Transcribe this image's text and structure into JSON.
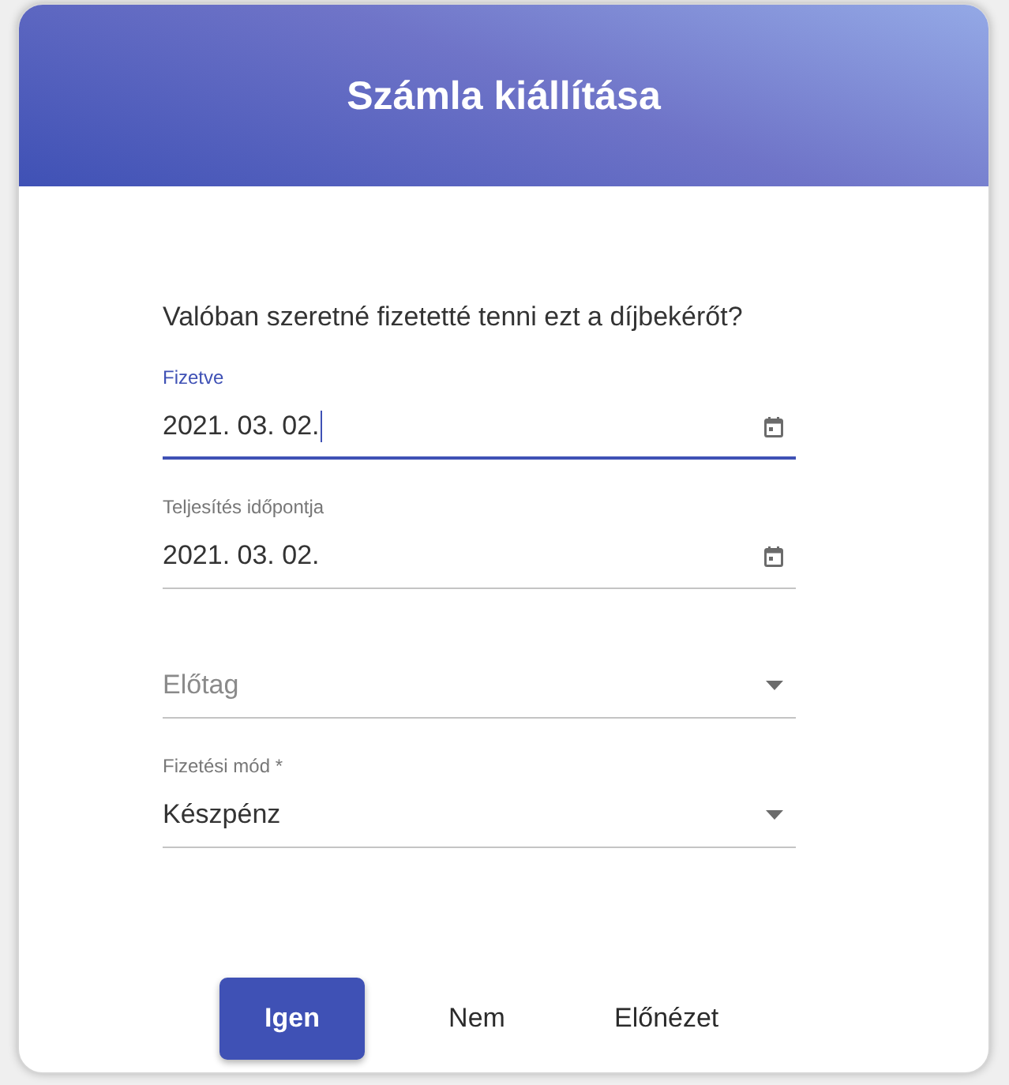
{
  "title": "Számla kiállítása",
  "question": "Valóban szeretné fizetetté tenni ezt a díjbekérőt?",
  "fields": [
    {
      "kind": "date",
      "label": "Fizetve",
      "value": "2021. 03. 02.",
      "focused": true
    },
    {
      "kind": "date",
      "label": "Teljesítés időpontja",
      "value": "2021. 03. 02.",
      "focused": false
    },
    {
      "kind": "select",
      "placeholder": "Előtag",
      "focused": false
    },
    {
      "kind": "select",
      "label": "Fizetési mód *",
      "value": "Készpénz",
      "focused": false
    }
  ],
  "buttons": [
    {
      "label": "Igen",
      "kind": "primary"
    },
    {
      "label": "Nem",
      "kind": "text"
    },
    {
      "label": "Előnézet",
      "kind": "text"
    }
  ]
}
